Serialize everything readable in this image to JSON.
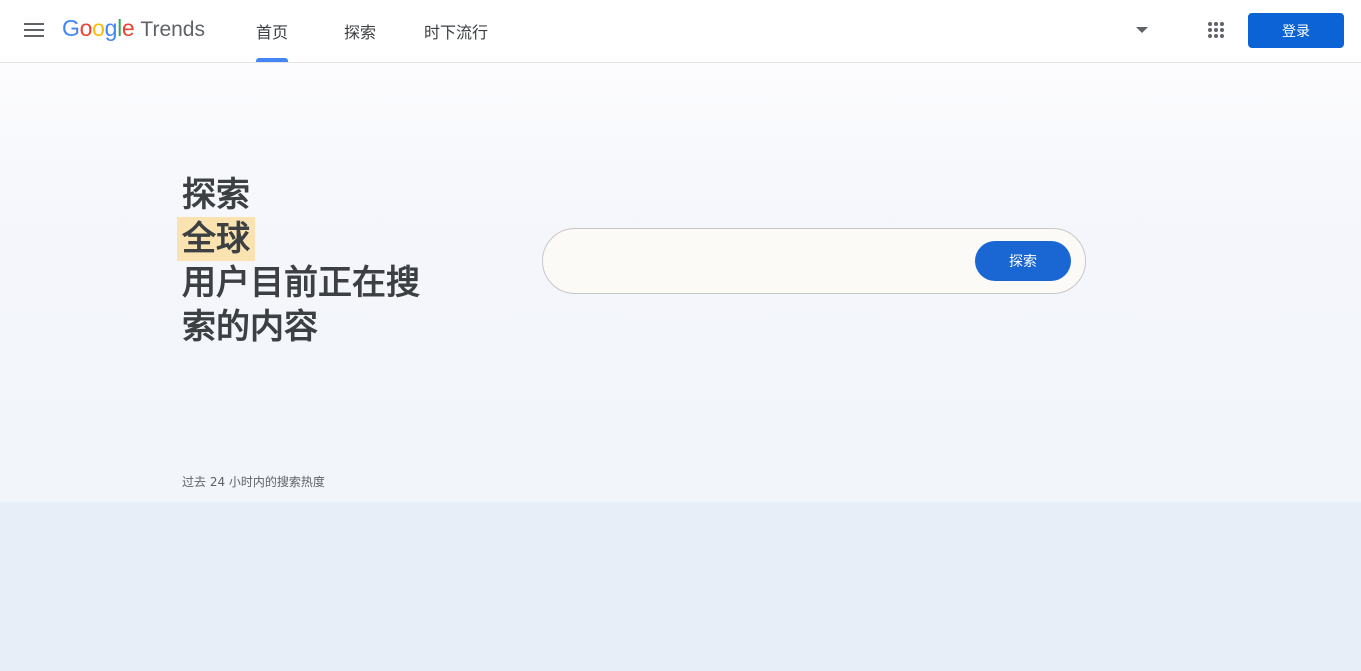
{
  "header": {
    "menu_icon": "hamburger-menu-icon",
    "logo": {
      "google_letters": [
        {
          "ch": "G",
          "color": "#4285F4"
        },
        {
          "ch": "o",
          "color": "#EA4335"
        },
        {
          "ch": "o",
          "color": "#FBBC05"
        },
        {
          "ch": "g",
          "color": "#4285F4"
        },
        {
          "ch": "l",
          "color": "#34A853"
        },
        {
          "ch": "e",
          "color": "#EA4335"
        }
      ],
      "product": "Trends"
    },
    "tabs": [
      {
        "label": "首页",
        "active": true
      },
      {
        "label": "探索",
        "active": false
      },
      {
        "label": "时下流行",
        "active": false
      }
    ],
    "language_dropdown_icon": "caret-down-icon",
    "apps_icon": "google-apps-grid-icon",
    "signin_label": "登录"
  },
  "hero": {
    "headline": {
      "line1": "探索",
      "line2_highlight": "全球",
      "line3": "用户目前正在搜",
      "line4": "索的内容"
    },
    "search": {
      "value": "",
      "placeholder": "",
      "button_label": "探索"
    },
    "caption": "过去 24 小时内的搜索热度"
  },
  "colors": {
    "accent": "#0b63d6",
    "search_button": "#1a66d2",
    "tab_indicator": "#4285f4",
    "highlight": "#fae3b0",
    "hero_bg": "#f4f6fb",
    "lower_bg": "#e8eef8"
  }
}
